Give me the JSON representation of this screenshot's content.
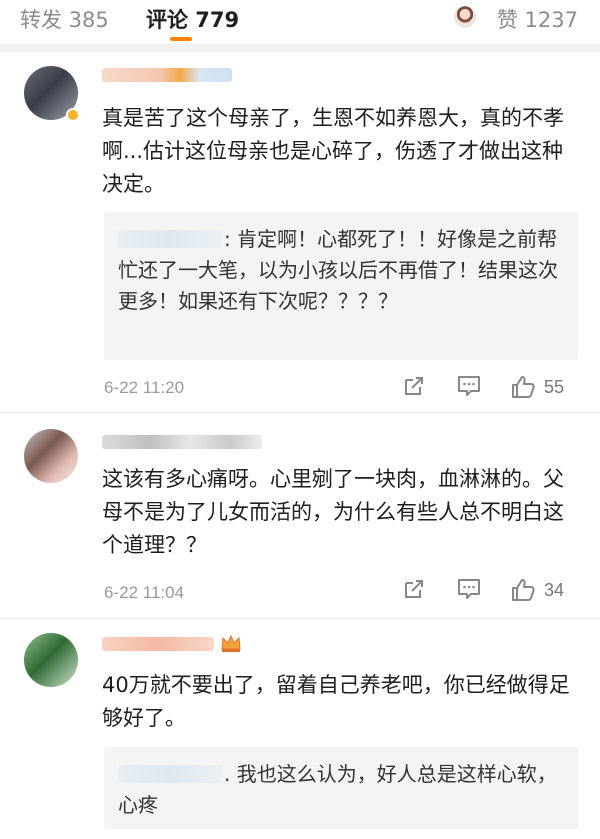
{
  "tabs": {
    "repost_label": "转发 385",
    "comment_label": "评论 779",
    "like_label": "赞 1237"
  },
  "comments": [
    {
      "body": "真是苦了这个母亲了，生恩不如养恩大，真的不孝啊...估计这位母亲也是心碎了，伤透了才做出这种决定。",
      "reply": ": 肯定啊！心都死了！！好像是之前帮忙还了一大笔，以为小孩以后不再借了！结果这次更多！如果还有下次呢？？？？",
      "time": "6-22 11:20",
      "likes": "55"
    },
    {
      "body": "这该有多心痛呀。心里剜了一块肉，血淋淋的。父母不是为了儿女而活的，为什么有些人总不明白这个道理？？",
      "time": "6-22 11:04",
      "likes": "34"
    },
    {
      "body": "40万就不要出了，留着自己养老吧，你已经做得足够好了。",
      "reply": ". 我也这么认为，好人总是这样心软，心疼"
    }
  ],
  "colors": {
    "accent": "#ff8200",
    "muted": "#9a9a9a",
    "reply_bg": "#f4f4f4"
  }
}
